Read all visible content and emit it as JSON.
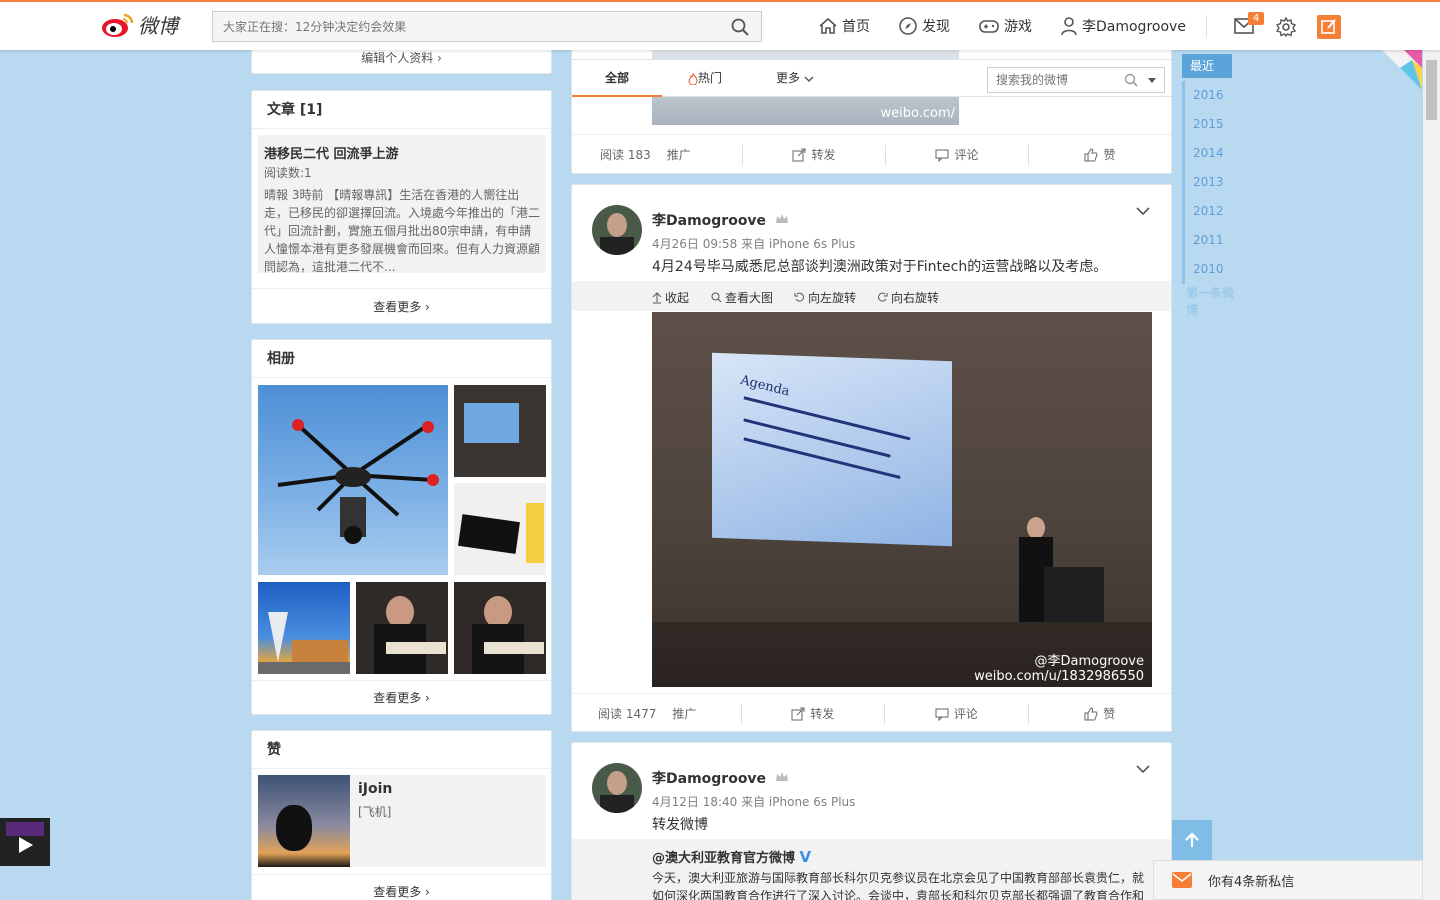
{
  "header": {
    "logo_text": "微博",
    "search_placeholder": "大家正在搜：12分钟决定约会效果",
    "nav": [
      {
        "label": "首页",
        "icon": "home-icon"
      },
      {
        "label": "发现",
        "icon": "compass-icon"
      },
      {
        "label": "游戏",
        "icon": "gamepad-icon"
      },
      {
        "label": "李Damogroove",
        "icon": "user-icon"
      }
    ],
    "mail_badge": "4"
  },
  "left": {
    "edit_profile": "编辑个人资料 ›",
    "articles": {
      "title": "文章 [1]",
      "item_title": "港移民二代 回流爭上游",
      "read_count": "阅读数:1",
      "excerpt": "晴報 3時前 【晴報專訊】生活在香港的人嚮往出走，已移民的卻選擇回流。入境處今年推出的「港二代」回流計劃，實施五個月批出80宗申請，有申請人憧憬本港有更多發展機會而回來。但有人力資源顧問認為，這批港二代不...",
      "more": "查看更多 ›"
    },
    "album": {
      "title": "相册",
      "more": "查看更多 ›"
    },
    "likes": {
      "title": "赞",
      "name": "iJoin",
      "desc": "[飞机]",
      "more": "查看更多 ›"
    }
  },
  "feed": {
    "tabs": {
      "all": "全部",
      "hot": "热门",
      "more": "更多"
    },
    "search_placeholder": "搜索我的微博",
    "posts": [
      {
        "read": "阅读 183",
        "promote": "推广",
        "forward": "转发",
        "comment": "评论",
        "like": "赞",
        "watermark": "weibo.com/"
      },
      {
        "user": "李Damogroove",
        "meta": "4月26日 09:58 来自 iPhone 6s Plus",
        "text": "4月24号毕马威悉尼总部谈判澳洲政策对于Fintech的运营战略以及考虑。",
        "media_actions": [
          "收起",
          "查看大图",
          "向左旋转",
          "向右旋转"
        ],
        "watermark_user": "@李Damogroove",
        "watermark_url": "weibo.com/u/1832986550",
        "slide_title": "Agenda",
        "read": "阅读 1477",
        "promote": "推广",
        "forward": "转发",
        "comment": "评论",
        "like": "赞"
      },
      {
        "user": "李Damogroove",
        "meta": "4月12日 18:40 来自 iPhone 6s Plus",
        "text": "转发微博",
        "repost_user": "@澳大利亚教育官方微博",
        "repost_text": "今天，澳大利亚旅游与国际教育部长科尔贝克参议员在北京会见了中国教育部部长袁贵仁，就如何深化两国教育合作进行了深入讨论。会谈中，袁部长和科尔贝克部长都强调了教育合作和"
      }
    ]
  },
  "timeline": {
    "current": "最近",
    "years": [
      "2016",
      "2015",
      "2014",
      "2013",
      "2012",
      "2011",
      "2010"
    ],
    "first": "第一条微博"
  },
  "private_msg": "你有4条新私信",
  "colors": {
    "accent": "#f77e36",
    "bg": "#b8d9ef",
    "link": "#5f9ed6"
  }
}
